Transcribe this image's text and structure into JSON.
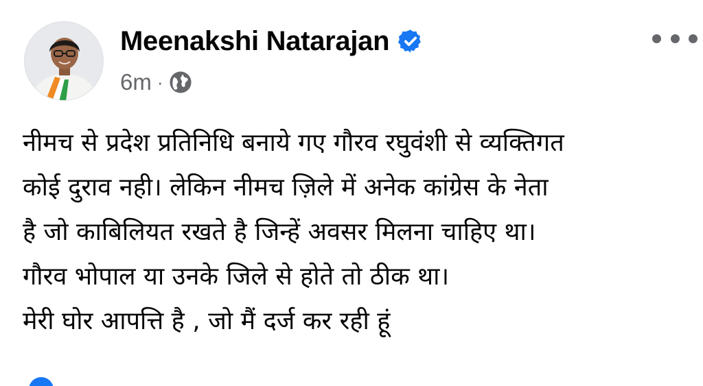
{
  "post": {
    "author_name": "Meenakshi Natarajan",
    "verified": true,
    "timestamp": "6m",
    "separator": "·",
    "audience_icon": "globe-icon",
    "more_icon": "more-horizontal-icon",
    "body_lines": [
      "नीमच से प्रदेश प्रतिनिधि बनाये गए गौरव रघुवंशी से व्यक्तिगत",
      "कोई दुराव नही। लेकिन नीमच ज़िले में अनेक कांग्रेस के नेता",
      "है जो काबिलियत रखते है जिन्हें अवसर मिलना चाहिए था।",
      "गौरव भोपाल या उनके जिले से होते तो ठीक था।",
      "मेरी घोर आपत्ति है , जो मैं दर्ज कर रही हूं"
    ]
  },
  "colors": {
    "verified_badge": "#1877f2",
    "secondary_text": "#65676b",
    "primary_text": "#050505",
    "reaction_like": "#1877f2"
  }
}
